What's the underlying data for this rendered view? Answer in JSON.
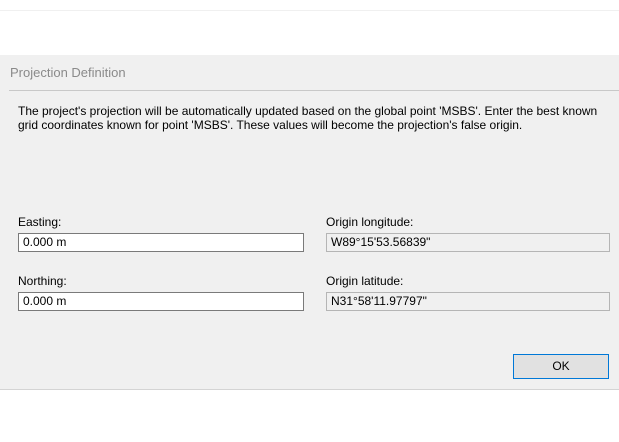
{
  "dialog": {
    "title": "Projection Definition",
    "description": "The project's projection will be automatically updated based on the global point 'MSBS'. Enter the best known grid coordinates known for point 'MSBS'. These values will become the projection's false origin.",
    "easting": {
      "label": "Easting:",
      "value": "0.000 m"
    },
    "northing": {
      "label": "Northing:",
      "value": "0.000 m"
    },
    "origin_longitude": {
      "label": "Origin longitude:",
      "value": "W89°15'53.56839\""
    },
    "origin_latitude": {
      "label": "Origin latitude:",
      "value": "N31°58'11.97797\""
    },
    "ok_label": "OK"
  },
  "colors": {
    "dialog_bg": "#f0f0f0",
    "button_accent": "#0078d7",
    "title_text": "#8a8a8a"
  }
}
